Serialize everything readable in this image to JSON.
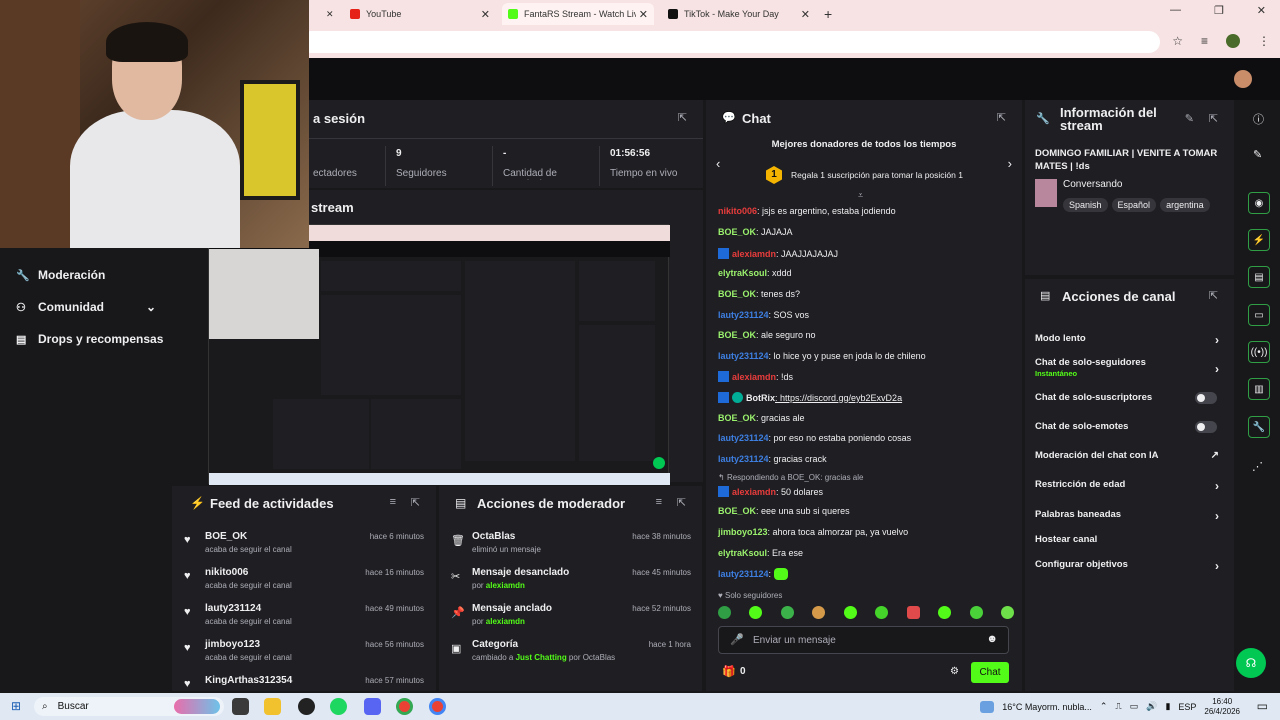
{
  "browser": {
    "tabs": [
      {
        "label": "YouTube",
        "icon": "youtube-icon"
      },
      {
        "label": "FantaRS Stream - Watch Live o",
        "icon": "kick-icon"
      },
      {
        "label": "TikTok - Make Your Day",
        "icon": "tiktok-icon"
      }
    ],
    "new_tab": "+"
  },
  "nav": {
    "items": [
      {
        "label": "Moderación",
        "icon": "wrench-icon"
      },
      {
        "label": "Comunidad",
        "icon": "community-icon"
      },
      {
        "label": "Drops y recompensas",
        "icon": "chart-icon"
      }
    ]
  },
  "session": {
    "title": "a sesión",
    "stats": [
      {
        "value": "",
        "label": "ectadores"
      },
      {
        "value": "9",
        "label": "Seguidores"
      },
      {
        "value": "-",
        "label": "Cantidad de suscripciones"
      },
      {
        "value": "01:56:56",
        "label": "Tiempo en vivo"
      }
    ]
  },
  "stream_preview": {
    "title": "stream"
  },
  "feed": {
    "title": "Feed de actividades",
    "items": [
      {
        "name": "BOE_OK",
        "sub": "acaba de seguir el canal",
        "time": "hace 6 minutos"
      },
      {
        "name": "nikito006",
        "sub": "acaba de seguir el canal",
        "time": "hace 16 minutos"
      },
      {
        "name": "lauty231124",
        "sub": "acaba de seguir el canal",
        "time": "hace 49 minutos"
      },
      {
        "name": "jimboyo123",
        "sub": "acaba de seguir el canal",
        "time": "hace 56 minutos"
      },
      {
        "name": "KingArthas312354",
        "sub": "",
        "time": "hace 57 minutos"
      }
    ]
  },
  "modactions": {
    "title": "Acciones de moderador",
    "items": [
      {
        "name": "OctaBlas",
        "sub1": "eliminó un mensaje",
        "sub2": "",
        "sub3": "",
        "time": "hace 38 minutos",
        "icon": "trash-icon"
      },
      {
        "name": "Mensaje desanclado",
        "sub1": "por ",
        "sub2": "alexiamdn",
        "sub3": "",
        "time": "hace 45 minutos",
        "icon": "unpin-icon"
      },
      {
        "name": "Mensaje anclado",
        "sub1": "por ",
        "sub2": "alexiamdn",
        "sub3": "",
        "time": "hace 52 minutos",
        "icon": "pin-icon"
      },
      {
        "name": "Categoría",
        "sub1": "cambiado a ",
        "sub2": "Just Chatting",
        "sub3": " por OctaBlas",
        "time": "hace 1 hora",
        "icon": "category-icon"
      }
    ]
  },
  "chat": {
    "title": "Chat",
    "donors_title": "Mejores donadores de todos los tiempos",
    "donors_rank": "1",
    "donors_text": "Regala 1 suscripción para tomar la posición 1",
    "messages": [
      {
        "user": "nikito006",
        "color": "u-red",
        "text": ": jsjs es argentino, estaba jodiendo"
      },
      {
        "user": "BOE_OK",
        "color": "u-green",
        "text": ": JAJAJA"
      },
      {
        "user": "alexiamdn",
        "color": "u-red",
        "text": ": JAAJJAJAJAJ"
      },
      {
        "user": "elytraKsoul",
        "color": "u-green",
        "text": ": xddd"
      },
      {
        "user": "BOE_OK",
        "color": "u-green",
        "text": ": tenes ds?"
      },
      {
        "user": "lauty231124",
        "color": "u-blue",
        "text": ": SOS vos"
      },
      {
        "user": "BOE_OK",
        "color": "u-green",
        "text": ": ale seguro no"
      },
      {
        "user": "lauty231124",
        "color": "u-blue",
        "text": ": lo hice yo y puse en joda lo de chileno"
      },
      {
        "user": "alexiamdn",
        "color": "u-red",
        "text": ": !ds"
      },
      {
        "user": "BotRix",
        "color": "u-white",
        "text": ": https://discord.gg/eyb2ExvD2a"
      },
      {
        "user": "BOE_OK",
        "color": "u-green",
        "text": ": gracias ale"
      },
      {
        "user": "lauty231124",
        "color": "u-blue",
        "text": ": por eso no estaba poniendo cosas"
      },
      {
        "user": "lauty231124",
        "color": "u-blue",
        "text": ": gracias crack"
      },
      {
        "user": "alexiamdn",
        "color": "u-red",
        "text": ": 50 dolares"
      },
      {
        "user": "BOE_OK",
        "color": "u-green",
        "text": ": eee una sub si queres"
      },
      {
        "user": "jimboyo123",
        "color": "u-green",
        "text": ": ahora toca almorzar pa, ya vuelvo"
      },
      {
        "user": "elytraKsoul",
        "color": "u-green",
        "text": ": Era ese"
      },
      {
        "user": "lauty231124",
        "color": "u-blue",
        "text": ": "
      }
    ],
    "reply_note": "Respondiendo a BOE_OK: gracias ale",
    "followers_only": "Solo seguidores",
    "input_placeholder": "Enviar un mensaje",
    "count": "0",
    "send_label": "Chat"
  },
  "info": {
    "title": "Información del stream",
    "stream_title": "DOMINGO FAMILIAR | VENITE A TOMAR MATES | !ds",
    "category": "Conversando",
    "tags": [
      "Spanish",
      "Español",
      "argentina"
    ]
  },
  "channel_actions": {
    "title": "Acciones de canal",
    "items": [
      {
        "label": "Modo lento",
        "sub": "",
        "control": "chevron"
      },
      {
        "label": "Chat de solo-seguidores",
        "sub": "Instantáneo",
        "control": "chevron"
      },
      {
        "label": "Chat de solo-suscriptores",
        "sub": "",
        "control": "toggle"
      },
      {
        "label": "Chat de solo-emotes",
        "sub": "",
        "control": "toggle"
      },
      {
        "label": "Moderación del chat con IA",
        "sub": "",
        "control": "external"
      },
      {
        "label": "Restricción de edad",
        "sub": "",
        "control": "chevron"
      },
      {
        "label": "Palabras baneadas",
        "sub": "",
        "control": "chevron"
      },
      {
        "label": "Hostear canal",
        "sub": "",
        "control": "none"
      },
      {
        "label": "Configurar objetivos",
        "sub": "",
        "control": "chevron"
      }
    ]
  },
  "taskbar": {
    "search": "Buscar",
    "weather": "16°C  Mayorm. nubla...",
    "lang": "ESP",
    "time": "16:40",
    "date": "26/4/2026"
  },
  "colors": {
    "accent": "#53fc18",
    "bg": "#18181b",
    "panel": "#1f1f23"
  }
}
